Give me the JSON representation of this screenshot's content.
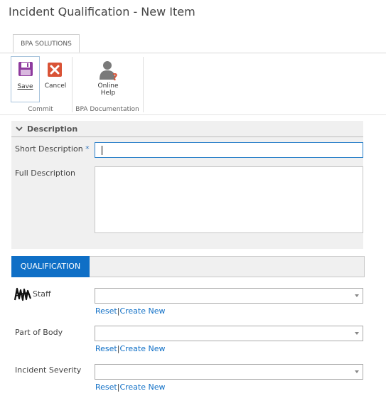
{
  "page": {
    "title": "Incident Qualification - New Item"
  },
  "ribbon": {
    "tab_label": "BPA SOLUTIONS",
    "save_label": "Save",
    "cancel_label": "Cancel",
    "help_label_line1": "Online",
    "help_label_line2": "Help",
    "groups": {
      "commit": "Commit",
      "documentation": "BPA Documentation"
    },
    "icons": {
      "save": "save-floppy-icon",
      "cancel": "cancel-x-icon",
      "help": "online-help-person-icon"
    },
    "colors": {
      "save": "#8e3a9e",
      "cancel": "#d95336"
    }
  },
  "description_section": {
    "title": "Description",
    "short_description_label": "Short Description",
    "required_marker": "*",
    "short_description_value": "",
    "full_description_label": "Full Description",
    "full_description_value": ""
  },
  "qualification_section": {
    "tab_label": "QUALIFICATION",
    "accent_color": "#0f6fc6",
    "fields": [
      {
        "label": "Staff",
        "value": "",
        "reset_label": "Reset",
        "separator": "|",
        "create_label": "Create New"
      },
      {
        "label": "Part of Body",
        "value": "",
        "reset_label": "Reset",
        "separator": "|",
        "create_label": "Create New"
      },
      {
        "label": "Incident Severity",
        "value": "",
        "reset_label": "Reset",
        "separator": "|",
        "create_label": "Create New"
      }
    ]
  }
}
